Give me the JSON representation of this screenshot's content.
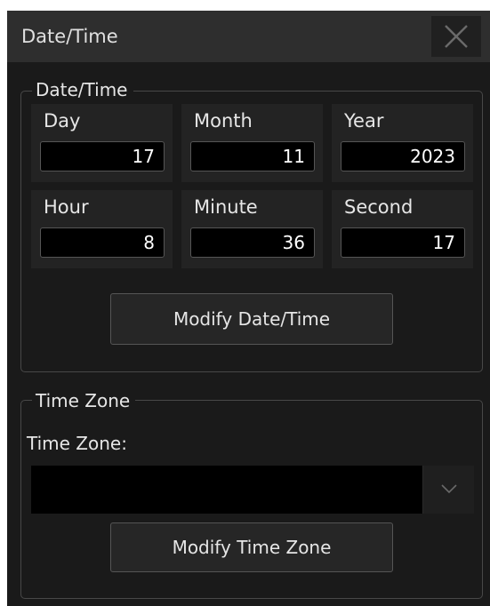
{
  "dialog": {
    "title": "Date/Time",
    "close_icon": "close-icon"
  },
  "date_time_group": {
    "legend": "Date/Time",
    "fields": [
      {
        "label": "Day",
        "value": "17"
      },
      {
        "label": "Month",
        "value": "11"
      },
      {
        "label": "Year",
        "value": "2023"
      },
      {
        "label": "Hour",
        "value": "8"
      },
      {
        "label": "Minute",
        "value": "36"
      },
      {
        "label": "Second",
        "value": "17"
      }
    ],
    "modify_button": "Modify Date/Time"
  },
  "time_zone_group": {
    "legend": "Time Zone",
    "field_label": "Time Zone:",
    "selected_value": "",
    "dropdown_icon": "chevron-down-icon",
    "modify_button": "Modify Time Zone"
  },
  "colors": {
    "dialog_background": "#1a1a1a",
    "titlebar_background": "#2e2e2e",
    "field_background": "#000000",
    "text": "#e6e6e6"
  }
}
